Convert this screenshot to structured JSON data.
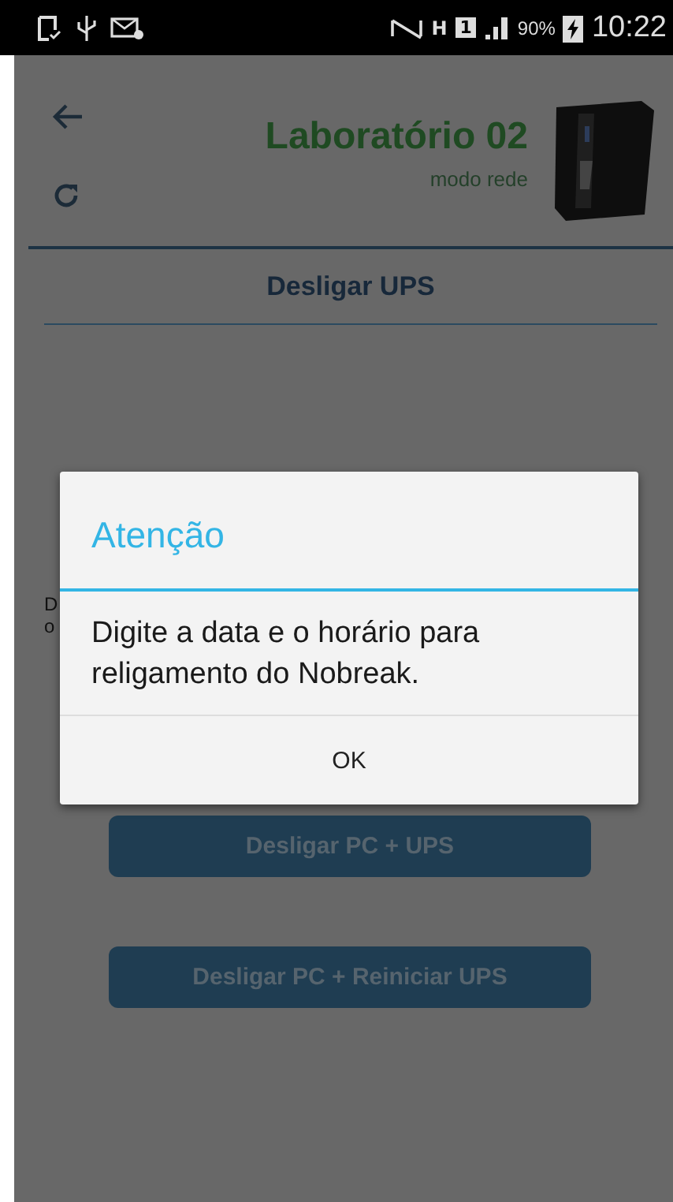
{
  "status_bar": {
    "network": "H",
    "sim": "1",
    "battery": "90%",
    "time": "10:22"
  },
  "header": {
    "title": "Laboratório 02",
    "subtitle": "modo rede"
  },
  "section_title": "Desligar UPS",
  "background_text": [
    "D",
    "o"
  ],
  "buttons": [
    {
      "label": "Desligar PC + UPS",
      "disabled": true
    },
    {
      "label": "Desligar PC + Reiniciar UPS",
      "disabled": true
    }
  ],
  "dialog": {
    "title": "Atenção",
    "message": "Digite a data e o horário para religamento do Nobreak.",
    "button": "OK"
  }
}
